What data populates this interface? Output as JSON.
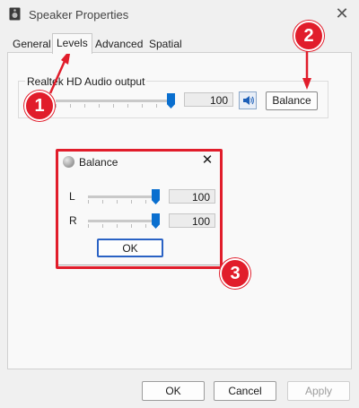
{
  "window": {
    "title": "Speaker Properties",
    "close_glyph": "✕"
  },
  "tabs": [
    {
      "label": "General",
      "active": false
    },
    {
      "label": "Levels",
      "active": true
    },
    {
      "label": "Advanced",
      "active": false
    },
    {
      "label": "Spatial sound",
      "active": false
    }
  ],
  "levels": {
    "group_label": "Realtek HD Audio output",
    "volume_value": "100",
    "mute_icon": "speaker-icon",
    "balance_button": "Balance"
  },
  "balance_dialog": {
    "title": "Balance",
    "close_glyph": "✕",
    "channels": [
      {
        "label": "L",
        "value": "100"
      },
      {
        "label": "R",
        "value": "100"
      }
    ],
    "ok_button": "OK"
  },
  "footer": {
    "ok": "OK",
    "cancel": "Cancel",
    "apply": "Apply"
  },
  "annotations": {
    "step1": "1",
    "step2": "2",
    "step3": "3",
    "accent_color": "#e11d2b"
  }
}
